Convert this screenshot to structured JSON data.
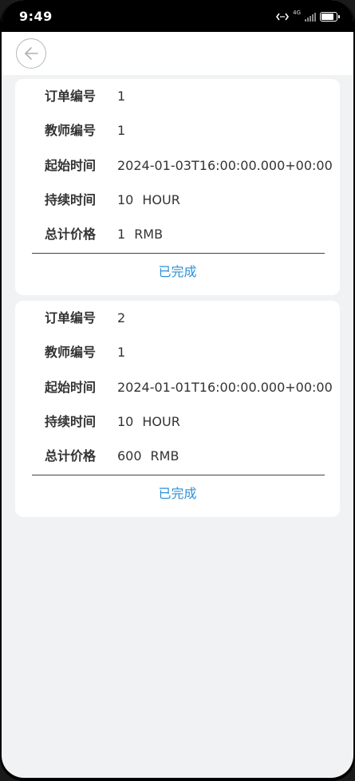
{
  "status_bar": {
    "time": "9:49",
    "network": "4G"
  },
  "header": {
    "back_icon": "arrow-left-circle-icon"
  },
  "orders": [
    {
      "id_label": "订单编号",
      "id": "1",
      "teacher_label": "教师编号",
      "teacher": "1",
      "start_label": "起始时间",
      "start": "2024-01-03T16:00:00.000+00:00",
      "duration_label": "持续时间",
      "duration": "10",
      "duration_unit": "HOUR",
      "price_label": "总计价格",
      "price": "1",
      "price_unit": "RMB",
      "status": "已完成"
    },
    {
      "id_label": "订单编号",
      "id": "2",
      "teacher_label": "教师编号",
      "teacher": "1",
      "start_label": "起始时间",
      "start": "2024-01-01T16:00:00.000+00:00",
      "duration_label": "持续时间",
      "duration": "10",
      "duration_unit": "HOUR",
      "price_label": "总计价格",
      "price": "600",
      "price_unit": "RMB",
      "status": "已完成"
    }
  ],
  "colors": {
    "accent": "#2e8fd8",
    "background": "#f1f2f4",
    "card": "#ffffff"
  },
  "battery_level": 0.85
}
